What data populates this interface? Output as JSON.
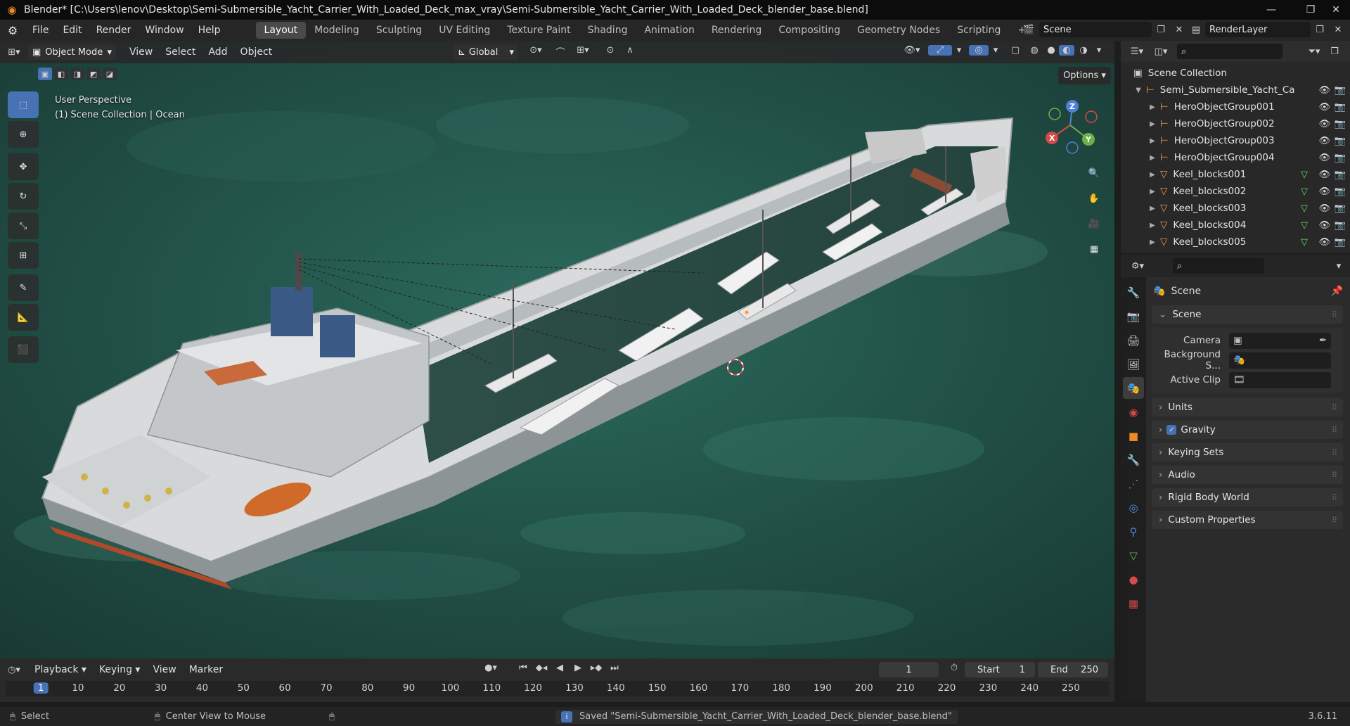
{
  "titlebar": {
    "title": "Blender* [C:\\Users\\lenov\\Desktop\\Semi-Submersible_Yacht_Carrier_With_Loaded_Deck_max_vray\\Semi-Submersible_Yacht_Carrier_With_Loaded_Deck_blender_base.blend]"
  },
  "menus": [
    "File",
    "Edit",
    "Render",
    "Window",
    "Help"
  ],
  "workspaces": [
    "Layout",
    "Modeling",
    "Sculpting",
    "UV Editing",
    "Texture Paint",
    "Shading",
    "Animation",
    "Rendering",
    "Compositing",
    "Geometry Nodes",
    "Scripting",
    "+"
  ],
  "active_workspace": "Layout",
  "scene_selector": {
    "label": "Scene"
  },
  "renderlayer_selector": {
    "label": "RenderLayer"
  },
  "viewport_header": {
    "mode": "Object Mode",
    "menus": [
      "View",
      "Select",
      "Add",
      "Object"
    ],
    "orientation": "Global"
  },
  "viewport": {
    "info_line1": "User Perspective",
    "info_line2": "(1) Scene Collection | Ocean",
    "options_label": "Options",
    "water_color": "#1f4a42",
    "gizmo": {
      "x": "X",
      "y": "Y",
      "z": "Z"
    }
  },
  "toolbar_tools": [
    "select-box",
    "cursor",
    "move",
    "rotate",
    "scale",
    "transform",
    "annotate",
    "measure",
    "add-cube"
  ],
  "outliner": {
    "root": "Scene Collection",
    "items": [
      {
        "name": "Semi_Submersible_Yacht_Ca",
        "type": "collection",
        "indent": 1
      },
      {
        "name": "HeroObjectGroup001",
        "type": "empty",
        "indent": 2
      },
      {
        "name": "HeroObjectGroup002",
        "type": "empty",
        "indent": 2
      },
      {
        "name": "HeroObjectGroup003",
        "type": "empty",
        "indent": 2
      },
      {
        "name": "HeroObjectGroup004",
        "type": "empty",
        "indent": 2
      },
      {
        "name": "Keel_blocks001",
        "type": "mesh",
        "indent": 2
      },
      {
        "name": "Keel_blocks002",
        "type": "mesh",
        "indent": 2
      },
      {
        "name": "Keel_blocks003",
        "type": "mesh",
        "indent": 2
      },
      {
        "name": "Keel_blocks004",
        "type": "mesh",
        "indent": 2
      },
      {
        "name": "Keel_blocks005",
        "type": "mesh",
        "indent": 2
      }
    ]
  },
  "properties": {
    "context_title": "Scene",
    "section": "Scene",
    "rows": [
      {
        "label": "Camera"
      },
      {
        "label": "Background S..."
      },
      {
        "label": "Active Clip"
      }
    ],
    "panels": [
      "Units",
      "Gravity",
      "Keying Sets",
      "Audio",
      "Rigid Body World",
      "Custom Properties"
    ],
    "gravity_checked": true
  },
  "timeline": {
    "menus": [
      "Playback",
      "Keying",
      "View",
      "Marker"
    ],
    "current_frame": "1",
    "start_label": "Start",
    "start": "1",
    "end_label": "End",
    "end": "250",
    "ruler": [
      "1",
      "10",
      "20",
      "30",
      "40",
      "50",
      "60",
      "70",
      "80",
      "90",
      "100",
      "110",
      "120",
      "130",
      "140",
      "150",
      "160",
      "170",
      "180",
      "190",
      "200",
      "210",
      "220",
      "230",
      "240",
      "250"
    ]
  },
  "statusbar": {
    "left1": "Select",
    "left2": "Center View to Mouse",
    "message": "Saved \"Semi-Submersible_Yacht_Carrier_With_Loaded_Deck_blender_base.blend\"",
    "version": "3.6.11"
  }
}
